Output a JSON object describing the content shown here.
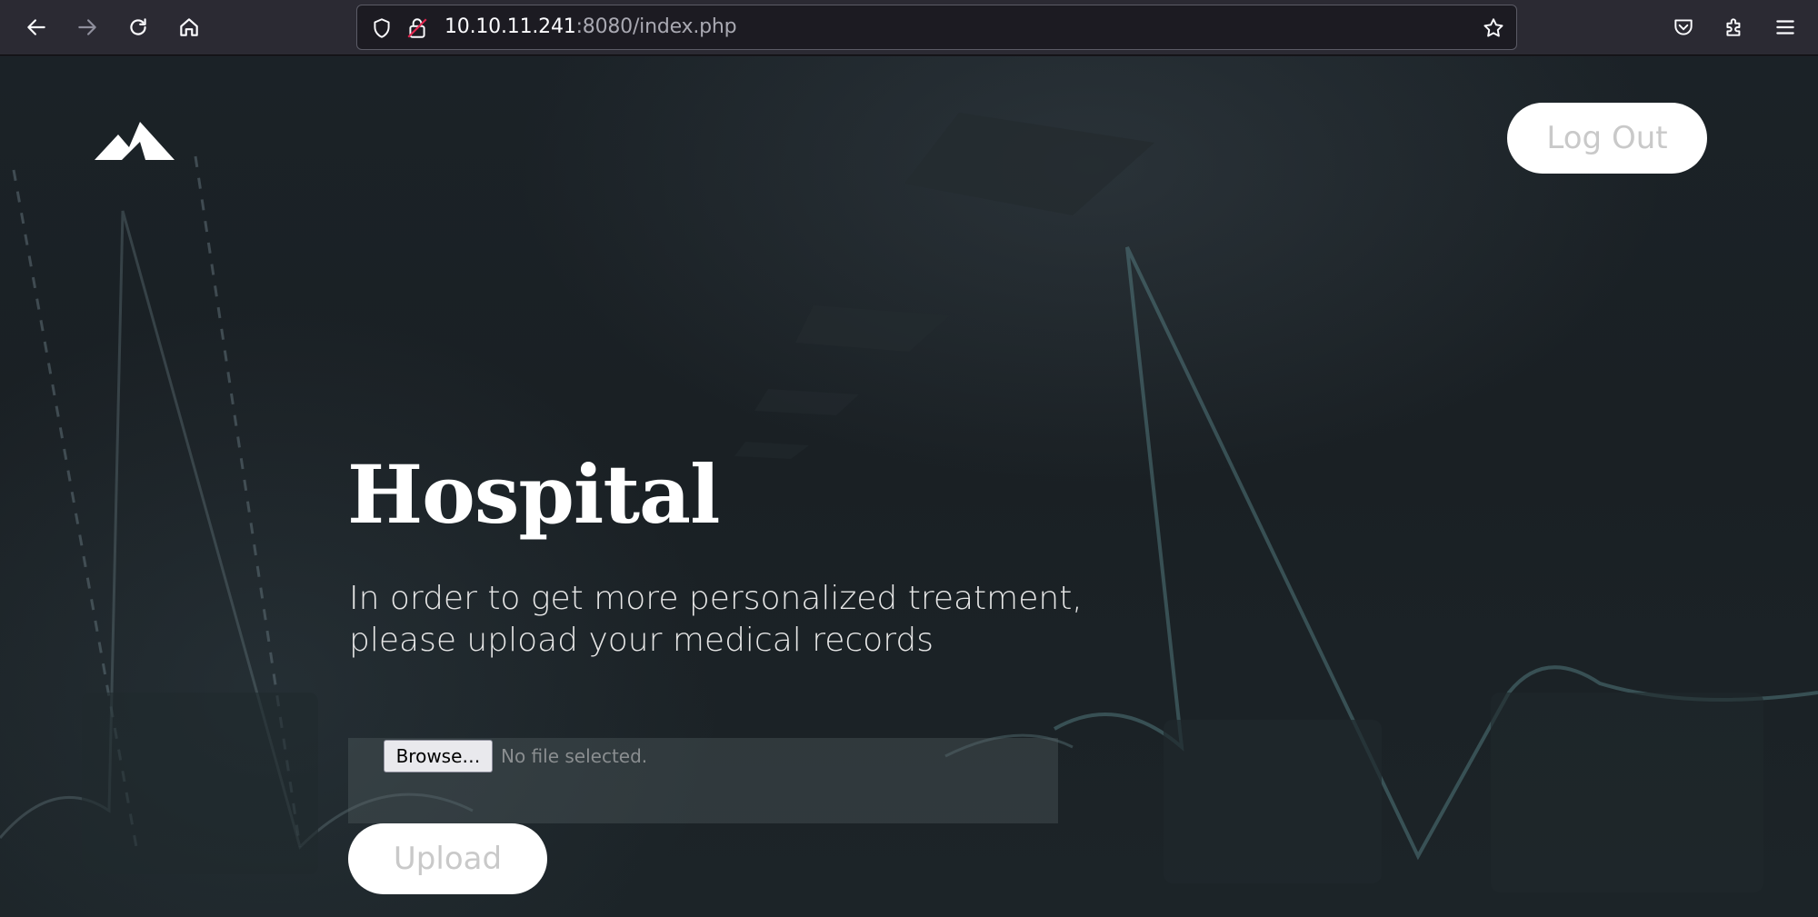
{
  "browser": {
    "url_host": "10.10.11.241",
    "url_rest": ":8080/index.php",
    "icons": [
      "back-icon",
      "forward-icon",
      "reload-icon",
      "home-icon",
      "shield-icon",
      "insecure-lock-icon",
      "bookmark-star-icon",
      "pocket-icon",
      "extensions-icon",
      "menu-icon"
    ]
  },
  "header": {
    "logo_icon": "mountain-logo-icon",
    "logout_label": "Log Out"
  },
  "main": {
    "title": "Hospital",
    "subtitle_line1": "In order to get more personalized treatment,",
    "subtitle_line2": "please upload your medical records",
    "browse_label": "Browse…",
    "file_status": "No file selected.",
    "upload_label": "Upload"
  },
  "colors": {
    "page_background": "#1a2024",
    "button_background": "#ffffff",
    "button_text": "#c9c9c9",
    "title_text": "#ffffff",
    "toolbar_background": "#2b2a33"
  }
}
